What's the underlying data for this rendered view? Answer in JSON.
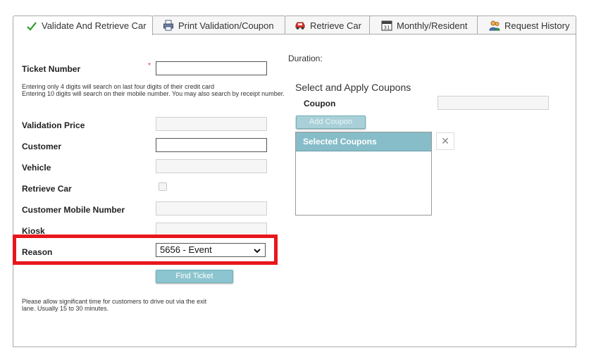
{
  "tabs": [
    {
      "label": "Validate And Retrieve Car",
      "icon": "checkmark-icon",
      "active": true
    },
    {
      "label": "Print Validation/Coupon",
      "icon": "printer-icon",
      "active": false
    },
    {
      "label": "Retrieve Car",
      "icon": "car-icon",
      "active": false
    },
    {
      "label": "Monthly/Resident",
      "icon": "calendar-icon",
      "active": false
    },
    {
      "label": "Request History",
      "icon": "users-icon",
      "active": false
    }
  ],
  "form": {
    "ticket_number_label": "Ticket Number",
    "required_mark": "*",
    "ticket_hint_1": "Entering only 4 digits will search on last four digits of their credit card",
    "ticket_hint_2": "Entering 10 digits will search on their mobile number. You may also search by receipt number.",
    "validation_price_label": "Validation Price",
    "customer_label": "Customer",
    "vehicle_label": "Vehicle",
    "retrieve_car_label": "Retrieve Car",
    "customer_mobile_label": "Customer Mobile Number",
    "kiosk_label": "Kiosk",
    "reason_label": "Reason",
    "reason_value": "5656 - Event",
    "find_ticket_button": "Find Ticket",
    "footer_note": "Please allow significant time for customers to drive out via the exit lane. Usually 15 to 30 minutes."
  },
  "right": {
    "duration_label": "Duration:",
    "coupons_heading": "Select and Apply Coupons",
    "coupon_label": "Coupon",
    "add_coupon_button": "Add Coupon",
    "selected_coupons_header": "Selected Coupons",
    "remove_symbol": "✕"
  },
  "colors": {
    "accent": "#86bdc8",
    "highlight": "#e8171c",
    "required": "#dd3333"
  }
}
